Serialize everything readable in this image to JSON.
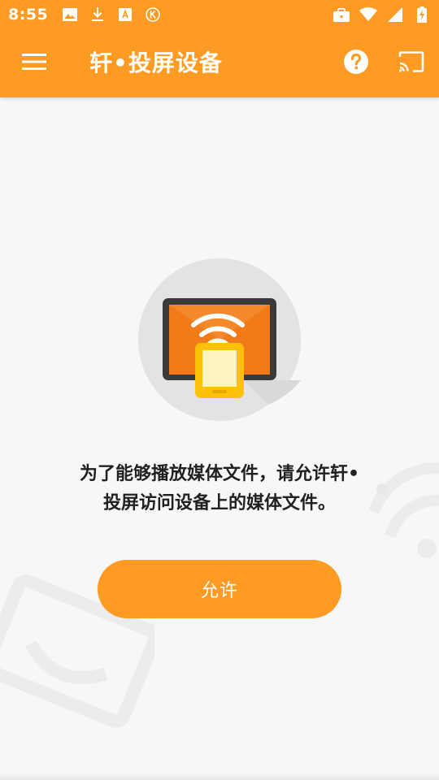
{
  "status_bar": {
    "time": "8:55",
    "left_icons": [
      "image-icon",
      "download-icon",
      "font-icon",
      "k-circle-icon"
    ],
    "right_icons": [
      "briefcase-icon",
      "wifi-icon",
      "signal-icon",
      "battery-charging-icon"
    ]
  },
  "app_bar": {
    "title": "轩•投屏设备",
    "menu_icon": "menu-icon",
    "help_icon": "help-icon",
    "cast_icon": "cast-icon"
  },
  "main": {
    "message_line1": "为了能够播放媒体文件，请允许轩•",
    "message_line2": "投屏访问设备上的媒体文件。",
    "allow_button_label": "允许"
  },
  "colors": {
    "accent": "#ff9a22",
    "background": "#f7f7f7",
    "text": "#212121",
    "illustration_circle": "#e3e3e3",
    "tv_screen": "#f07b18",
    "phone": "#ffc107"
  }
}
